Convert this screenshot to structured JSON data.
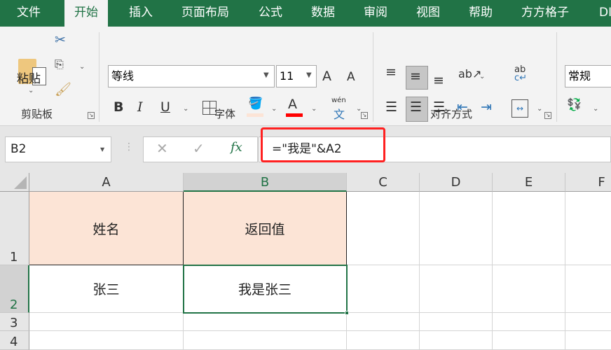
{
  "tabs": [
    "文件",
    "开始",
    "插入",
    "页面布局",
    "公式",
    "数据",
    "审阅",
    "视图",
    "帮助",
    "方方格子",
    "DI"
  ],
  "ribbon": {
    "clipboard": {
      "paste": "粘贴",
      "group": "剪贴板"
    },
    "font": {
      "name": "等线",
      "size": "11",
      "bold": "B",
      "italic": "I",
      "underline": "U",
      "font_color_glyph": "A",
      "phonetic_top": "wén",
      "phonetic_bottom": "文",
      "grow": "A",
      "shrink": "A",
      "group": "字体",
      "font_color": "#ff0000",
      "fill_color": "#fce4d6"
    },
    "alignment": {
      "group": "对齐方式",
      "wrap_top": "ab",
      "wrap_bottom": "c↵"
    },
    "number": {
      "format": "常规"
    }
  },
  "formula_bar": {
    "name_box": "B2",
    "cancel": "✕",
    "enter": "✓",
    "fx": "fx",
    "formula": "=\"我是\"&A2"
  },
  "columns": [
    "A",
    "B",
    "C",
    "D",
    "E",
    "F"
  ],
  "rows": [
    "1",
    "2",
    "3",
    "4"
  ],
  "cells": {
    "A1": "姓名",
    "B1": "返回值",
    "A2": "张三",
    "B2": "我是张三"
  },
  "colors": {
    "accent": "#217346",
    "header_fill": "#fce4d6",
    "highlight": "#ff2020"
  }
}
